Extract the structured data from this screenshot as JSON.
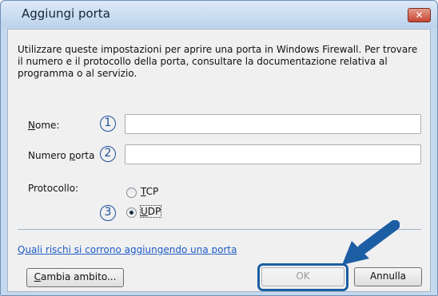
{
  "window": {
    "title": "Aggiungi porta",
    "close_glyph": "✕"
  },
  "description": "Utilizzare queste impostazioni per aprire una porta in Windows Firewall. Per trovare il numero e il protocollo della porta, consultare la documentazione relativa al programma o al servizio.",
  "fields": {
    "name": {
      "label": "Nome:",
      "accesskey": "N",
      "label_rest": "ome:",
      "value": "",
      "callout": "1"
    },
    "port": {
      "label_pre": "Numero ",
      "accesskey": "p",
      "label_rest": "orta",
      "value": "",
      "callout": "2"
    }
  },
  "protocol": {
    "label": "Protocollo:",
    "options": [
      {
        "accesskey": "T",
        "rest": "CP",
        "selected": false
      },
      {
        "accesskey": "U",
        "rest": "DP",
        "selected": true
      }
    ],
    "callout": "3"
  },
  "link": "Quali rischi si corrono aggiungendo una porta",
  "buttons": {
    "scope": {
      "accesskey": "C",
      "rest": "ambia ambito..."
    },
    "ok": "OK",
    "cancel": "Annulla"
  },
  "colors": {
    "accent": "#1c5ea3",
    "link": "#1e5bc6",
    "client_bg": "#f0f0f0"
  },
  "icons": {
    "close": "close-icon",
    "arrow": "pointer-arrow-icon"
  }
}
